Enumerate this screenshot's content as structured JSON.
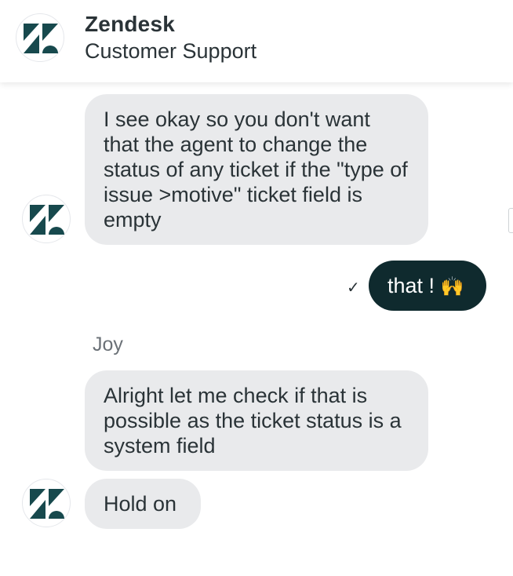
{
  "header": {
    "title": "Zendesk",
    "subtitle": "Customer Support",
    "logo_icon": "zendesk-logo-icon"
  },
  "messages": [
    {
      "direction": "incoming",
      "text": "I see okay so you don't want that the agent to change the status of any ticket if the \"type of issue >motive\" ticket field is empty"
    },
    {
      "direction": "outgoing",
      "text": "that ! ",
      "emoji": "🙌",
      "status_icon": "checkmark-icon",
      "status_glyph": "✓"
    },
    {
      "direction": "incoming",
      "sender": "Joy",
      "text": "Alright let me check if that is possible as the ticket status is a system field"
    },
    {
      "direction": "incoming",
      "text": "Hold on"
    }
  ],
  "colors": {
    "incoming_bubble": "#e9eaec",
    "outgoing_bubble": "#0f2a2e",
    "brand_dark": "#17494d"
  }
}
